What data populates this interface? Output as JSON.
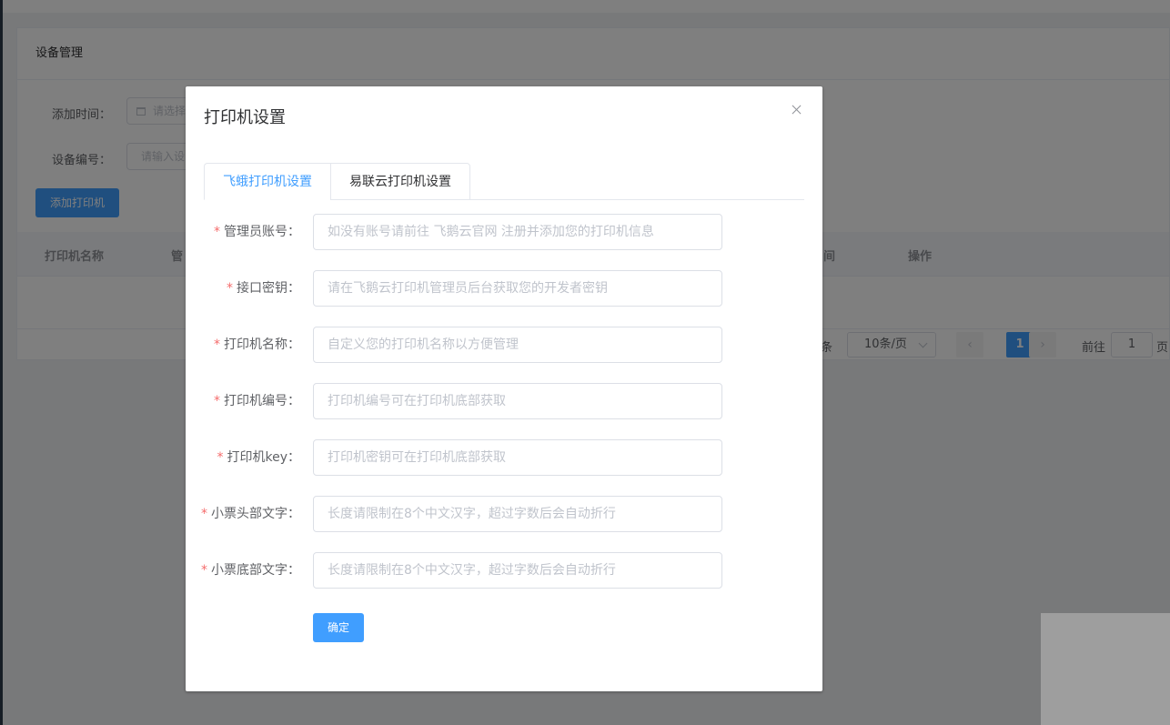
{
  "page": {
    "card_title": "设备管理",
    "filters": {
      "add_time_label": "添加时间：",
      "add_time_placeholder": "请选择",
      "device_no_label": "设备编号：",
      "device_no_placeholder": "请输入设"
    },
    "add_printer_button": "添加打印机",
    "table": {
      "columns": [
        "打印机名称",
        "管",
        "间",
        "操作"
      ]
    },
    "pagination": {
      "total_suffix": "条",
      "page_size": "10条/页",
      "prev": "‹",
      "current": "1",
      "next": "›",
      "goto_label": "前往",
      "goto_value": "1",
      "page_suffix": "页"
    }
  },
  "dialog": {
    "title": "打印机设置",
    "tabs": [
      {
        "label": "飞蛾打印机设置",
        "active": true
      },
      {
        "label": "易联云打印机设置",
        "active": false
      }
    ],
    "fields": [
      {
        "label": "管理员账号：",
        "required": true,
        "placeholder": "如没有账号请前往 飞鹅云官网 注册并添加您的打印机信息",
        "value": ""
      },
      {
        "label": "接口密钥：",
        "required": true,
        "placeholder": "请在飞鹅云打印机管理员后台获取您的开发者密钥",
        "value": ""
      },
      {
        "label": "打印机名称：",
        "required": true,
        "placeholder": "自定义您的打印机名称以方便管理",
        "value": ""
      },
      {
        "label": "打印机编号：",
        "required": true,
        "placeholder": "打印机编号可在打印机底部获取",
        "value": ""
      },
      {
        "label": "打印机key：",
        "required": true,
        "placeholder": "打印机密钥可在打印机底部获取",
        "value": ""
      },
      {
        "label": "小票头部文字：",
        "required": true,
        "placeholder": "长度请限制在8个中文汉字，超过字数后会自动折行",
        "value": ""
      },
      {
        "label": "小票底部文字：",
        "required": true,
        "placeholder": "长度请限制在8个中文汉字，超过字数后会自动折行",
        "value": ""
      }
    ],
    "required_mark": "*",
    "submit_label": "确定"
  },
  "colors": {
    "primary": "#409eff",
    "required": "#f56c6c",
    "overlay": "rgba(0,0,0,0.5)"
  }
}
